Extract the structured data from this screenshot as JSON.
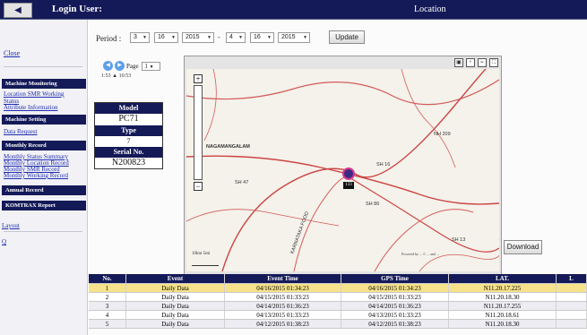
{
  "topbar": {
    "back_label": "◀",
    "login_label": "Login User:",
    "page_title": "Location"
  },
  "sidebar": {
    "close_link": "Close",
    "machine_monitoring": {
      "header": "Machine Monitoring",
      "links": [
        "Location SMR Working",
        "Status",
        "Attribute Information"
      ]
    },
    "machine_setting": {
      "header": "Machine Setting",
      "links": [
        "Data Request"
      ]
    },
    "monthly_record": {
      "header": "Monthly Record",
      "links": [
        "Monthly Status Summary",
        "Monthly Location Record",
        "Monthly SMR Record",
        "Monthly Working Record"
      ]
    },
    "annual_record": {
      "header": "Annual Record"
    },
    "komtrax_report": {
      "header": "KOMTRAX Report"
    },
    "bottom_links": [
      "Layout",
      "Q"
    ]
  },
  "period": {
    "label": "Period :",
    "start_month": "3",
    "start_day": "16",
    "start_year": "2015",
    "separator": "-",
    "end_month": "4",
    "end_day": "16",
    "end_year": "2015",
    "update_label": "Update"
  },
  "paging": {
    "page_label": "Page",
    "page_value": "1",
    "time_range": "1:53 ▲ 10:53"
  },
  "machine": {
    "model_label": "Model",
    "model_value": "PC71",
    "type_label": "Type",
    "type_value": "7",
    "serial_label": "Serial No.",
    "serial_value": "N200823"
  },
  "map": {
    "place_label": "NAGAMANGALAM",
    "road_labels": [
      "SH 16",
      "SH 86",
      "NH 209",
      "SH 47",
      "SH 13"
    ],
    "side_label": "KARNATAKA FOOD",
    "marker_label": "133",
    "scale_label": "10km 5mi",
    "copyright": "Powered by ... © ... and ..."
  },
  "download_label": "Download",
  "grid": {
    "columns": [
      "No.",
      "Event",
      "Event Time",
      "GPS Time",
      "LAT.",
      "L"
    ],
    "rows": [
      {
        "no": "1",
        "event": "Daily Data",
        "event_time": "04/16/2015 01:34:23",
        "gps_time": "04/16/2015 01:34:23",
        "lat": "N11.20.17.225"
      },
      {
        "no": "2",
        "event": "Daily Data",
        "event_time": "04/15/2015 01:33:23",
        "gps_time": "04/15/2015 01:33:23",
        "lat": "N11.20.18.30"
      },
      {
        "no": "3",
        "event": "Daily Data",
        "event_time": "04/14/2015 01:36:23",
        "gps_time": "04/14/2015 01:36:23",
        "lat": "N11.20.17.255"
      },
      {
        "no": "4",
        "event": "Daily Data",
        "event_time": "04/13/2015 01:33:23",
        "gps_time": "04/13/2015 01:33:23",
        "lat": "N11.20.18.61"
      },
      {
        "no": "5",
        "event": "Daily Data",
        "event_time": "04/12/2015 01:38:23",
        "gps_time": "04/12/2015 01:38:23",
        "lat": "N11.20.18.30"
      }
    ]
  },
  "colors": {
    "navy": "#141a58",
    "selected_row": "#f5e28a",
    "link": "#1f2eb0"
  }
}
